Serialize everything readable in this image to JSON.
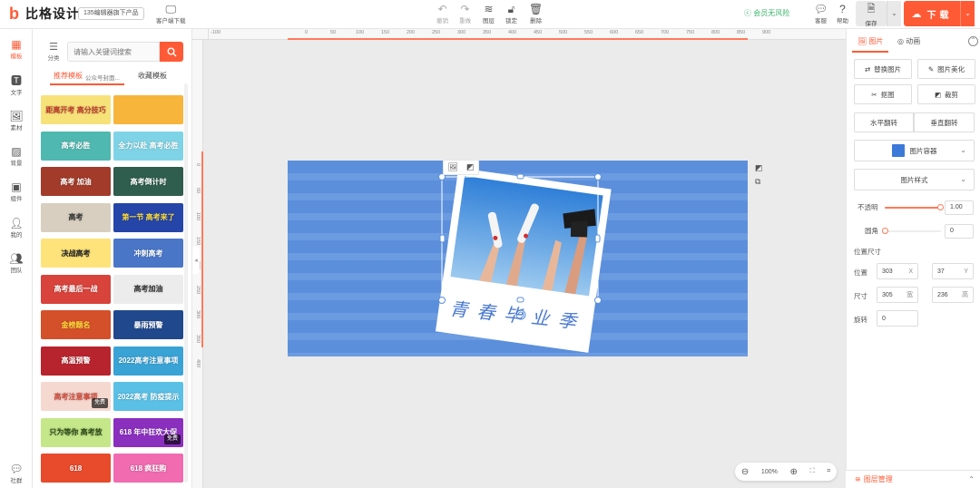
{
  "brand": {
    "name": "比格设计",
    "badge": "135编辑器旗下产品",
    "client_download": "客户端下载"
  },
  "toolbar": {
    "undo": "撤销",
    "redo": "重做",
    "layers": "图层",
    "lock": "锁定",
    "delete": "删除"
  },
  "vip": "会员无风险",
  "feedback": "客服",
  "help": "帮助",
  "save": "保存",
  "download": "下载",
  "leftnav": [
    {
      "label": "模板",
      "icon": "template-icon",
      "active": true
    },
    {
      "label": "文字",
      "icon": "text-icon"
    },
    {
      "label": "素材",
      "icon": "material-icon"
    },
    {
      "label": "背景",
      "icon": "background-icon"
    },
    {
      "label": "组件",
      "icon": "component-icon"
    },
    {
      "label": "我的",
      "icon": "user-icon"
    },
    {
      "label": "团队",
      "icon": "team-icon"
    },
    {
      "label": "社群",
      "icon": "community-icon"
    }
  ],
  "templates": {
    "category_label": "分类",
    "search_placeholder": "请输入关键词搜索",
    "tabs": {
      "recommended": "推荐模板",
      "sub": "公众号封面...",
      "favorites": "收藏模板"
    },
    "thumbs": [
      {
        "text": "距离开考 高分技巧",
        "bg": "#f7e27a",
        "color": "#c0392b"
      },
      {
        "text": "",
        "bg": "#f7b53b",
        "color": "#fff"
      },
      {
        "text": "高考必胜",
        "bg": "#4fb8b0",
        "color": "#fff"
      },
      {
        "text": "全力以赴 高考必胜",
        "bg": "#7ed4e6",
        "color": "#fff"
      },
      {
        "text": "高考 加油",
        "bg": "#a23b2a",
        "color": "#fff"
      },
      {
        "text": "高考倒计时",
        "bg": "#2f5d4e",
        "color": "#fff"
      },
      {
        "text": "高考",
        "bg": "#d9cfc0",
        "color": "#333"
      },
      {
        "text": "第一节 高考来了",
        "bg": "#2545a8",
        "color": "#ffde3b"
      },
      {
        "text": "决战高考",
        "bg": "#fde37a",
        "color": "#222"
      },
      {
        "text": "冲刺高考",
        "bg": "#4a76c8",
        "color": "#fff"
      },
      {
        "text": "高考最后一战",
        "bg": "#d8433b",
        "color": "#fff"
      },
      {
        "text": "高考加油",
        "bg": "#ececec",
        "color": "#333"
      },
      {
        "text": "金榜题名",
        "bg": "#d4502a",
        "color": "#ffde3b"
      },
      {
        "text": "暴雨预警",
        "bg": "#20488c",
        "color": "#fff"
      },
      {
        "text": "高温预警",
        "bg": "#b8242e",
        "color": "#fff"
      },
      {
        "text": "2022高考注意事项",
        "bg": "#3aa3d6",
        "color": "#fff"
      },
      {
        "text": "高考注意事项",
        "bg": "#f5d9d0",
        "color": "#d24a3a",
        "badge": "免费"
      },
      {
        "text": "2022高考 防疫提示",
        "bg": "#5ac0e6",
        "color": "#fff"
      },
      {
        "text": "只为等你 高考放",
        "bg": "#c5e78a",
        "color": "#2b4a15"
      },
      {
        "text": "618 年中狂欢大促",
        "bg": "#8b2fbf",
        "color": "#fff",
        "badge": "免费"
      },
      {
        "text": "618",
        "bg": "#e84a2c",
        "color": "#fff"
      },
      {
        "text": "618 疯狂购",
        "bg": "#f06bb0",
        "color": "#fff"
      }
    ]
  },
  "canvas": {
    "ruler_h": [
      "-100",
      "0",
      "50",
      "100",
      "150",
      "200",
      "250",
      "300",
      "350",
      "400",
      "450",
      "500",
      "550",
      "600",
      "650",
      "700",
      "750",
      "800",
      "850",
      "900"
    ],
    "ruler_v": [
      "0",
      "50",
      "100",
      "150",
      "200",
      "250",
      "300",
      "350",
      "400"
    ],
    "card_text": "青春毕业季",
    "zoom": "100%"
  },
  "props": {
    "tab_image": "图片",
    "tab_anim": "动画",
    "btn_replace": "替换图片",
    "btn_beautify": "图片美化",
    "btn_cutout": "抠图",
    "btn_crop": "裁剪",
    "btn_flip_h": "水平翻转",
    "btn_flip_v": "垂直翻转",
    "img_container": "图片容器",
    "img_style": "图片样式",
    "opacity_label": "不透明",
    "opacity_value": "1.00",
    "opacity": 1.0,
    "radius_label": "圆角",
    "radius_value": "0",
    "pos_size_label": "位置尺寸",
    "pos_label": "位置",
    "x": "303",
    "x_unit": "X",
    "y": "37",
    "y_unit": "Y",
    "size_label": "尺寸",
    "w": "305",
    "w_unit": "宽",
    "h": "236",
    "h_unit": "高",
    "rotate_label": "旋转",
    "rotate": "0",
    "layer_manager": "图层管理"
  }
}
